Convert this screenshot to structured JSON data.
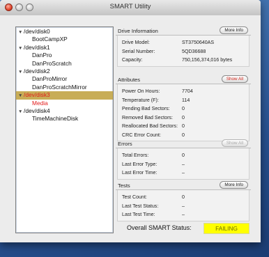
{
  "window": {
    "title": "SMART Utility"
  },
  "tree": [
    {
      "label": "/dev/disk0",
      "type": "parent"
    },
    {
      "label": "BootCampXP",
      "type": "child"
    },
    {
      "label": "/dev/disk1",
      "type": "parent"
    },
    {
      "label": "DanPro",
      "type": "child"
    },
    {
      "label": "DanProScratch",
      "type": "child"
    },
    {
      "label": "/dev/disk2",
      "type": "parent"
    },
    {
      "label": "DanProMirror",
      "type": "child"
    },
    {
      "label": "DanProScratchMirror",
      "type": "child"
    },
    {
      "label": "/dev/disk3",
      "type": "parent",
      "selected": true,
      "red": true
    },
    {
      "label": "Media",
      "type": "child",
      "red": true
    },
    {
      "label": "/dev/disk4",
      "type": "parent"
    },
    {
      "label": "TimeMachineDisk",
      "type": "child"
    }
  ],
  "drive_info": {
    "heading": "Drive Information",
    "button": "More Info",
    "rows": [
      {
        "k": "Drive Model:",
        "v": "ST3750640AS"
      },
      {
        "k": "Serial Number:",
        "v": "5QD36688"
      },
      {
        "k": "Capacity:",
        "v": "750,156,374,016 bytes"
      }
    ]
  },
  "attributes": {
    "heading": "Attributes",
    "button": "Show All",
    "rows": [
      {
        "k": "Power On Hours:",
        "v": "7704"
      },
      {
        "k": "Temperature (F):",
        "v": "114"
      },
      {
        "k": "Pending Bad Sectors:",
        "v": "0"
      },
      {
        "k": "Removed Bad Sectors:",
        "v": "0"
      },
      {
        "k": "Reallocated Bad Sectors:",
        "v": "0"
      },
      {
        "k": "CRC Error Count:",
        "v": "0"
      }
    ]
  },
  "errors": {
    "heading": "Errors",
    "button": "Show All",
    "rows": [
      {
        "k": "Total Errors:",
        "v": "0"
      },
      {
        "k": "Last Error Type:",
        "v": "–"
      },
      {
        "k": "Last Error Time:",
        "v": "–"
      }
    ]
  },
  "tests": {
    "heading": "Tests",
    "button": "More Info",
    "rows": [
      {
        "k": "Test Count:",
        "v": "0"
      },
      {
        "k": "Last Test Status:",
        "v": "–"
      },
      {
        "k": "Last Test Time:",
        "v": "–"
      }
    ]
  },
  "status": {
    "label": "Overall SMART Status:",
    "value": "FAILING",
    "color": "#ffff00"
  }
}
